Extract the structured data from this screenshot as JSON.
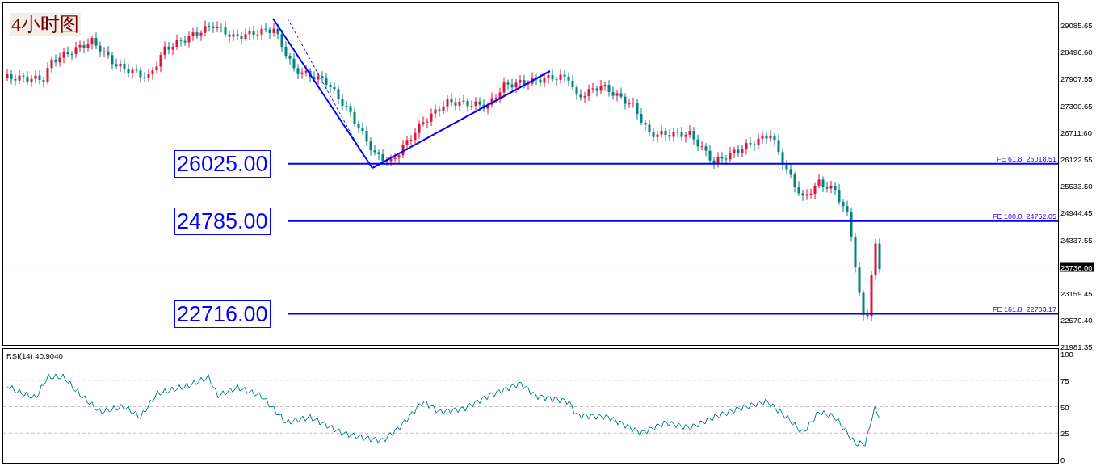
{
  "chart": {
    "title": "4小时图",
    "price_axis": [
      "29085.65",
      "28496.60",
      "27907.55",
      "27300.65",
      "26711.60",
      "26122.55",
      "25533.50",
      "24944.45",
      "24337.55",
      "23159.45",
      "22570.40",
      "21981.35"
    ],
    "current_price": "23736.00",
    "levels": [
      {
        "label": "26025.00",
        "tag": "FE 61.8",
        "value": "26018.51"
      },
      {
        "label": "24785.00",
        "tag": "FE 100.0",
        "value": "24752.05"
      },
      {
        "label": "22716.00",
        "tag": "FE 161.8",
        "value": "22703.17"
      }
    ]
  },
  "rsi": {
    "label": "RSI(14) 40.9040",
    "axis": [
      "100",
      "75",
      "50",
      "25",
      "0"
    ]
  }
}
